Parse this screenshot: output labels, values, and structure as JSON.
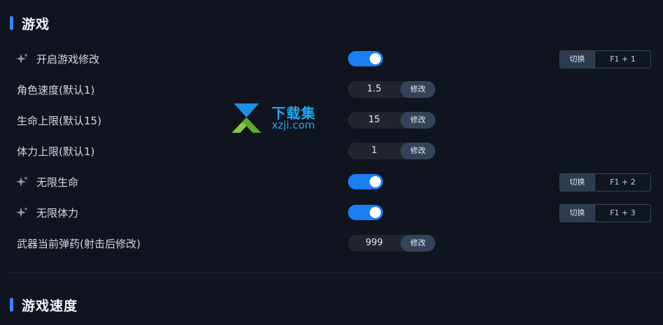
{
  "sections": [
    {
      "title": "游戏"
    },
    {
      "title": "游戏速度"
    }
  ],
  "rows": [
    {
      "label": "开启游戏修改",
      "type": "toggle",
      "on": true,
      "hotkey": {
        "switch_label": "切换",
        "keys": "F1 + 1"
      }
    },
    {
      "label": "角色速度(默认1)",
      "type": "number",
      "value": "1.5",
      "button_label": "修改"
    },
    {
      "label": "生命上限(默认15)",
      "type": "number",
      "value": "15",
      "button_label": "修改"
    },
    {
      "label": "体力上限(默认1)",
      "type": "number",
      "value": "1",
      "button_label": "修改"
    },
    {
      "label": "无限生命",
      "type": "toggle",
      "on": true,
      "hotkey": {
        "switch_label": "切换",
        "keys": "F1 + 2"
      }
    },
    {
      "label": "无限体力",
      "type": "toggle",
      "on": true,
      "hotkey": {
        "switch_label": "切换",
        "keys": "F1 + 3"
      }
    },
    {
      "label": "武器当前弹药(射击后修改)",
      "type": "number",
      "value": "999",
      "button_label": "修改"
    }
  ],
  "watermark": {
    "top_text": "下载集",
    "bottom_text": "xzji.com"
  },
  "colors": {
    "background": "#0f141e",
    "accent": "#1a7df0",
    "section_bar": "#3b82f6",
    "button": "#344359",
    "watermark": "#22a7f0"
  },
  "icons": {
    "sparkle": "sparkle-icon"
  }
}
